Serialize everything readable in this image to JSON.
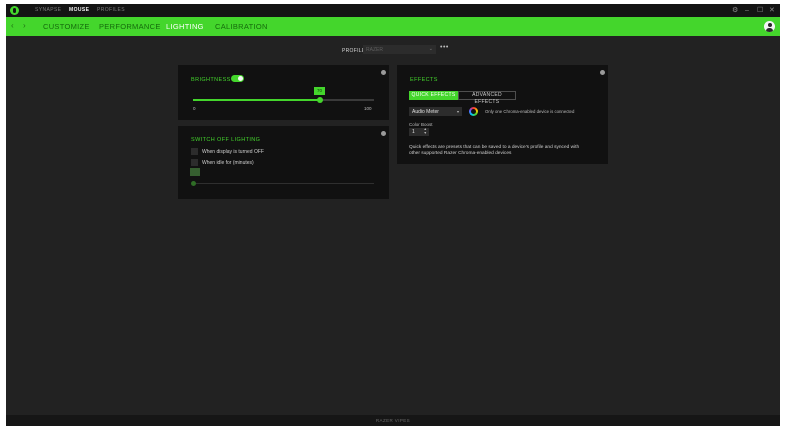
{
  "titlebar": {
    "tabs": [
      {
        "label": "SYNAPSE",
        "active": false
      },
      {
        "label": "MOUSE",
        "active": true
      },
      {
        "label": "PROFILES",
        "active": false
      }
    ],
    "window_buttons": {
      "settings": "⚙",
      "minimize": "–",
      "maximize": "☐",
      "close": "✕"
    }
  },
  "navbar": {
    "back": "‹",
    "forward": "›",
    "tabs": [
      {
        "label": "CUSTOMIZE",
        "active": false
      },
      {
        "label": "PERFORMANCE",
        "active": false
      },
      {
        "label": "LIGHTING",
        "active": true
      },
      {
        "label": "CALIBRATION",
        "active": false
      }
    ]
  },
  "profile": {
    "label": "PROFILE",
    "value": "RAZER",
    "more": "•••"
  },
  "brightness": {
    "title": "BRIGHTNESS",
    "enabled": true,
    "value": "70",
    "level": 0.7,
    "min": "0",
    "max": "100"
  },
  "switch_off": {
    "title": "SWITCH OFF LIGHTING",
    "option1": "When display is turned OFF",
    "option2": "When idle for (minutes)"
  },
  "effects": {
    "title": "EFFECTS",
    "quick_tab": "QUICK EFFECTS",
    "advanced_tab": "ADVANCED EFFECTS",
    "selected_effect": "Audio Meter",
    "chroma_note": "Only one Chroma-enabled device is connected",
    "color_boost_label": "Color Boost",
    "color_boost_value": "1",
    "description": "Quick effects are presets that can be saved to a device's profile and synced with other supported Razer Chroma-enabled devices"
  },
  "footer": {
    "label": "RAZER VIPES"
  },
  "colors": {
    "accent": "#44d62c",
    "background": "#222222",
    "panel": "#111111"
  },
  "icons": [
    "razer-logo-icon",
    "info-icon",
    "chroma-icon",
    "avatar-icon",
    "chevron-down-icon"
  ]
}
